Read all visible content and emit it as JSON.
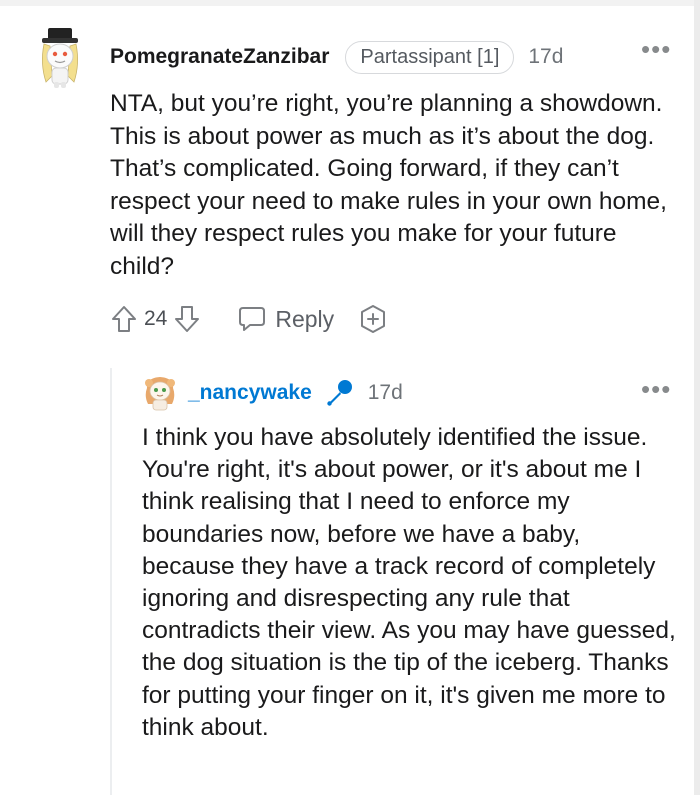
{
  "comment1": {
    "username": "PomegranateZanzibar",
    "flair": "Partassipant [1]",
    "time": "17d",
    "more": "•••",
    "body": "NTA, but you’re right, you’re planning a showdown. This is about power as much as it’s about the dog. That’s complicated. Going forward, if they can’t respect your need to make rules in your own home, will they respect rules you make for your future child?",
    "votes": "24",
    "reply_label": "Reply",
    "icons": [
      "upvote-icon",
      "downvote-icon",
      "reply-icon",
      "award-icon",
      "more-icon"
    ]
  },
  "comment2": {
    "username": "_nancywake",
    "time": "17d",
    "more": "•••",
    "body": "I think you have absolutely identified the issue. You're right, it's about power, or it's about me I think realising that I need to enforce my boundaries now, before we have a baby, because they have a track record of completely ignoring and disrespecting any rule that contradicts their view. As you may have guessed, the dog situation is the tip of the iceberg. Thanks for putting your finger on it, it's given me more to think about.",
    "icons": [
      "microphone-icon",
      "more-icon"
    ]
  },
  "colors": {
    "text": "#1a1a1b",
    "meta": "#6e7378",
    "op_username": "#0079d3",
    "mic": "#0079d3",
    "thread_line": "#eceef0"
  }
}
